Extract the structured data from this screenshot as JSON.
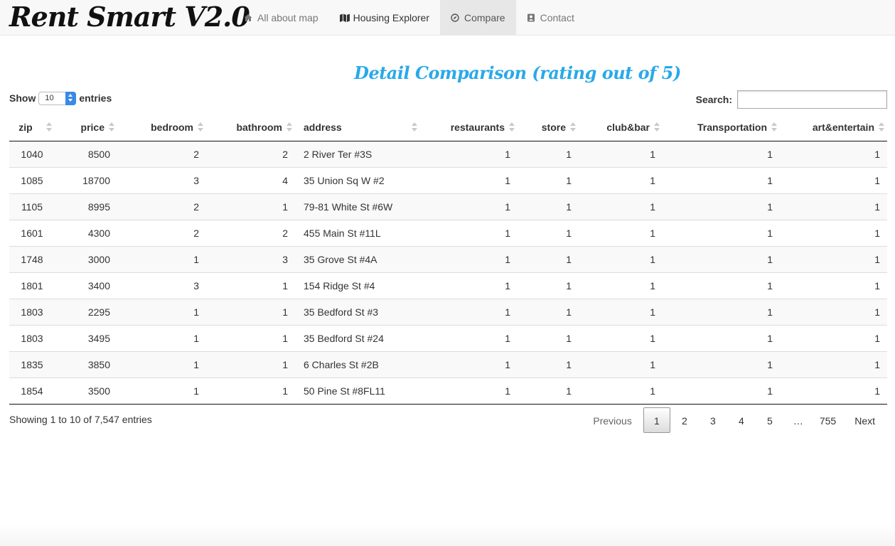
{
  "brand": "Rent Smart V2.0",
  "nav": [
    {
      "label": "All about map",
      "icon": "home-icon",
      "active": false
    },
    {
      "label": "Housing Explorer",
      "icon": "map-icon",
      "active": false
    },
    {
      "label": "Compare",
      "icon": "compass-icon",
      "active": true
    },
    {
      "label": "Contact",
      "icon": "contact-card-icon",
      "active": false
    }
  ],
  "heading": "Detail Comparison (rating out of 5)",
  "length": {
    "show_label": "Show",
    "value": "10",
    "entries_label": "entries"
  },
  "search": {
    "label": "Search:",
    "value": ""
  },
  "table": {
    "columns": [
      "zip",
      "price",
      "bedroom",
      "bathroom",
      "address",
      "restaurants",
      "store",
      "club&bar",
      "Transportation",
      "art&entertain"
    ],
    "rows": [
      [
        "1040",
        "8500",
        "2",
        "2",
        "2 River Ter #3S",
        "1",
        "1",
        "1",
        "1",
        "1"
      ],
      [
        "1085",
        "18700",
        "3",
        "4",
        "35 Union Sq W #2",
        "1",
        "1",
        "1",
        "1",
        "1"
      ],
      [
        "1105",
        "8995",
        "2",
        "1",
        "79-81 White St #6W",
        "1",
        "1",
        "1",
        "1",
        "1"
      ],
      [
        "1601",
        "4300",
        "2",
        "2",
        "455 Main St #11L",
        "1",
        "1",
        "1",
        "1",
        "1"
      ],
      [
        "1748",
        "3000",
        "1",
        "3",
        "35 Grove St #4A",
        "1",
        "1",
        "1",
        "1",
        "1"
      ],
      [
        "1801",
        "3400",
        "3",
        "1",
        "154 Ridge St #4",
        "1",
        "1",
        "1",
        "1",
        "1"
      ],
      [
        "1803",
        "2295",
        "1",
        "1",
        "35 Bedford St #3",
        "1",
        "1",
        "1",
        "1",
        "1"
      ],
      [
        "1803",
        "3495",
        "1",
        "1",
        "35 Bedford St #24",
        "1",
        "1",
        "1",
        "1",
        "1"
      ],
      [
        "1835",
        "3850",
        "1",
        "1",
        "6 Charles St #2B",
        "1",
        "1",
        "1",
        "1",
        "1"
      ],
      [
        "1854",
        "3500",
        "1",
        "1",
        "50 Pine St #8FL11",
        "1",
        "1",
        "1",
        "1",
        "1"
      ]
    ]
  },
  "info": "Showing 1 to 10 of 7,547 entries",
  "pagination": {
    "previous": "Previous",
    "pages": [
      "1",
      "2",
      "3",
      "4",
      "5",
      "…",
      "755"
    ],
    "current": "1",
    "next": "Next"
  },
  "colors": {
    "heading": "#2aa9e8",
    "navbar_bg": "#f8f8f8",
    "active_tab_bg": "#e7e7e7"
  }
}
